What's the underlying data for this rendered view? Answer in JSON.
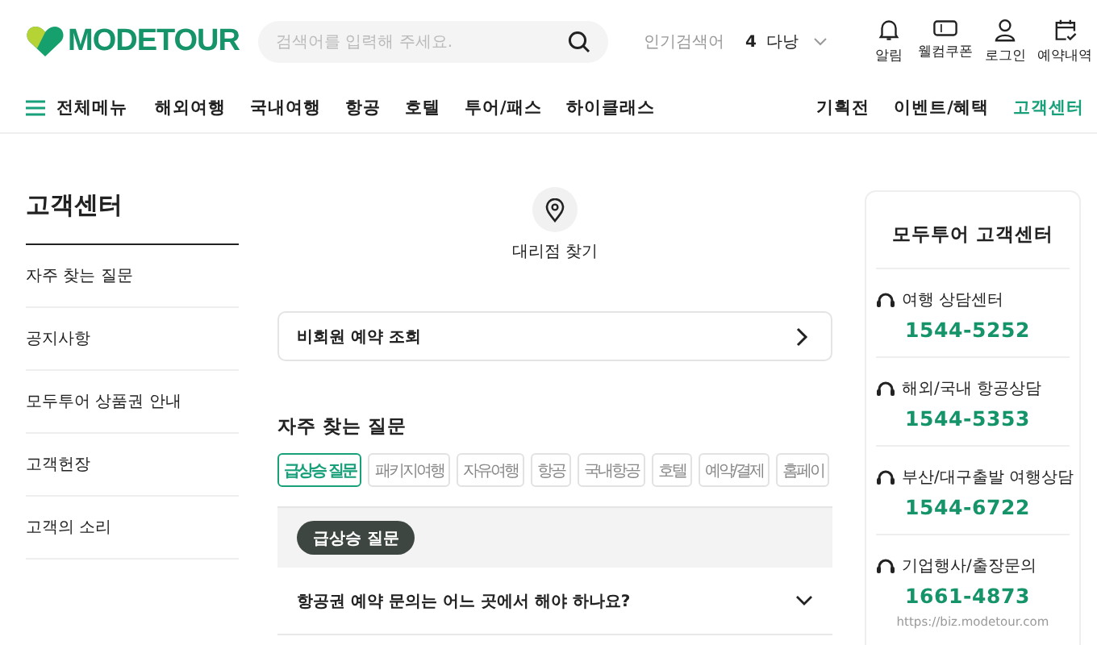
{
  "header": {
    "logo": "MODETOUR",
    "search": {
      "placeholder": "검색어를 입력해 주세요."
    },
    "popular": {
      "label": "인기검색어",
      "rank": "4",
      "keyword": "다낭"
    },
    "utilities": [
      {
        "kind": "bell",
        "label": "알림"
      },
      {
        "kind": "coupon",
        "label": "웰컴쿠폰"
      },
      {
        "kind": "person",
        "label": "로그인"
      },
      {
        "kind": "calendar",
        "label": "예약내역"
      }
    ]
  },
  "nav": {
    "menu_label": "전체메뉴",
    "items": [
      {
        "label": "해외여행",
        "selected": false
      },
      {
        "label": "국내여행",
        "selected": false
      },
      {
        "label": "항공",
        "selected": false
      },
      {
        "label": "호텔",
        "selected": false
      },
      {
        "label": "투어/패스",
        "selected": false
      },
      {
        "label": "하이클래스",
        "selected": false
      }
    ],
    "right_items": [
      {
        "label": "기획전",
        "selected": false
      },
      {
        "label": "이벤트/혜택",
        "selected": false
      },
      {
        "label": "고객센터",
        "selected": true
      }
    ]
  },
  "sidebar": {
    "title": "고객센터",
    "items": [
      {
        "label": "자주 찾는 질문"
      },
      {
        "label": "공지사항"
      },
      {
        "label": "모두투어 상품권 안내"
      },
      {
        "label": "고객헌장"
      },
      {
        "label": "고객의 소리"
      }
    ]
  },
  "branch_link": {
    "label": "대리점 찾기"
  },
  "nonmember": {
    "label": "비회원 예약 조회"
  },
  "faq": {
    "title": "자주 찾는 질문",
    "tabs": [
      {
        "label": "급상승 질문",
        "selected": true
      },
      {
        "label": "패키지여행",
        "selected": false
      },
      {
        "label": "자유여행",
        "selected": false
      },
      {
        "label": "항공",
        "selected": false
      },
      {
        "label": "국내항공",
        "selected": false
      },
      {
        "label": "호텔",
        "selected": false
      },
      {
        "label": "예약/결제",
        "selected": false
      },
      {
        "label": "홈페이",
        "selected": false
      }
    ],
    "chip": "급상승 질문",
    "questions": [
      {
        "text": "항공권 예약 문의는 어느 곳에서 해야 하나요?",
        "expanded": false
      }
    ]
  },
  "contact": {
    "title": "모두투어 고객센터",
    "lines": [
      {
        "label": "여행 상담센터",
        "phone": "1544-5252"
      },
      {
        "label": "해외/국내 항공상담",
        "phone": "1544-5353"
      },
      {
        "label": "부산/대구출발 여행상담",
        "phone": "1544-6722"
      },
      {
        "label": "기업행사/출장문의",
        "phone": "1661-4873",
        "url": "https://biz.modetour.com"
      }
    ]
  }
}
